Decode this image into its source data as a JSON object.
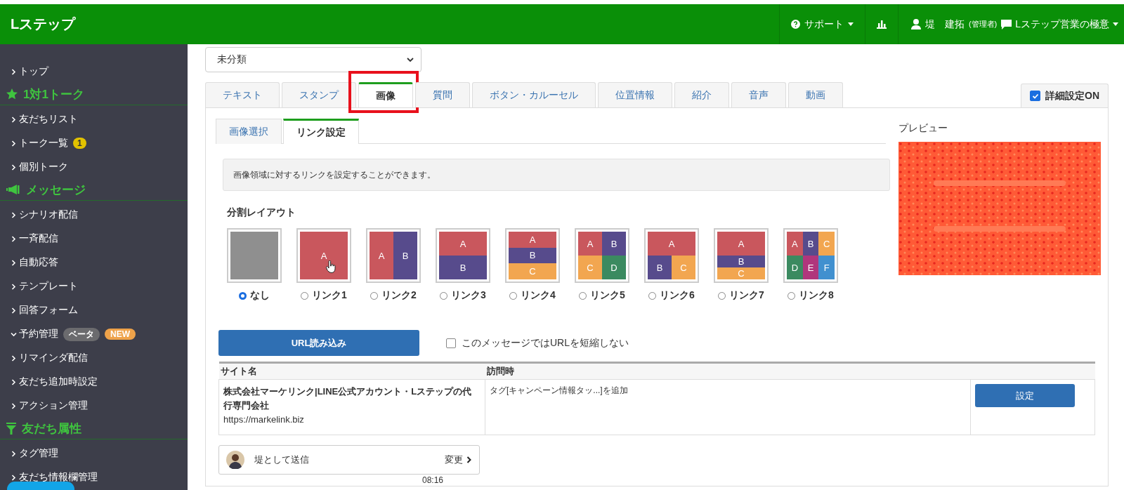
{
  "header": {
    "brand": "Lステップ",
    "support": "サポート",
    "user_name": "堤　建拓",
    "user_role": "(管理者)",
    "account": "Lステップ営業の極意"
  },
  "sidebar": {
    "items": [
      {
        "kind": "link",
        "label": "トップ",
        "expanded": false
      },
      {
        "kind": "section",
        "label": "1対1トーク"
      },
      {
        "kind": "link",
        "label": "友だちリスト",
        "expanded": false
      },
      {
        "kind": "link",
        "label": "トーク一覧",
        "expanded": false,
        "badges": [
          {
            "text": "1",
            "color": "#e2c200"
          }
        ]
      },
      {
        "kind": "link",
        "label": "個別トーク",
        "expanded": false
      },
      {
        "kind": "section",
        "label": "メッセージ"
      },
      {
        "kind": "link",
        "label": "シナリオ配信",
        "expanded": false
      },
      {
        "kind": "link",
        "label": "一斉配信",
        "expanded": false
      },
      {
        "kind": "link",
        "label": "自動応答",
        "expanded": false
      },
      {
        "kind": "link",
        "label": "テンプレート",
        "expanded": false
      },
      {
        "kind": "link",
        "label": "回答フォーム",
        "expanded": false
      },
      {
        "kind": "link",
        "label": "予約管理",
        "expanded": true,
        "badges": [
          {
            "text": "ベータ",
            "color": "#6b6b6e"
          },
          {
            "text": "NEW",
            "color": "#eea24a"
          }
        ]
      },
      {
        "kind": "link",
        "label": "リマインダ配信",
        "expanded": false
      },
      {
        "kind": "link",
        "label": "友だち追加時設定",
        "expanded": false
      },
      {
        "kind": "link",
        "label": "アクション管理",
        "expanded": false
      },
      {
        "kind": "section",
        "label": "友だち属性"
      },
      {
        "kind": "link",
        "label": "タグ管理",
        "expanded": false
      },
      {
        "kind": "link",
        "label": "友だち情報欄管理",
        "expanded": false
      }
    ]
  },
  "folder_select": {
    "value": "未分類"
  },
  "tabs": [
    {
      "label": "テキスト",
      "selected": false,
      "highlighted": false
    },
    {
      "label": "スタンプ",
      "selected": false,
      "highlighted": false
    },
    {
      "label": "画像",
      "selected": true,
      "highlighted": true
    },
    {
      "label": "質問",
      "selected": false,
      "highlighted": false
    },
    {
      "label": "ボタン・カルーセル",
      "selected": false,
      "highlighted": false
    },
    {
      "label": "位置情報",
      "selected": false,
      "highlighted": false
    },
    {
      "label": "紹介",
      "selected": false,
      "highlighted": false
    },
    {
      "label": "音声",
      "selected": false,
      "highlighted": false
    },
    {
      "label": "動画",
      "selected": false,
      "highlighted": false
    }
  ],
  "detail_toggle": {
    "label": "詳細設定ON",
    "checked": true
  },
  "subtabs": [
    {
      "label": "画像選択",
      "selected": false
    },
    {
      "label": "リンク設定",
      "selected": true
    }
  ],
  "info": "画像領域に対するリンクを設定することができます。",
  "layout_heading": "分割レイアウト",
  "layouts": [
    {
      "kind": "none",
      "label": "なし",
      "selected": true
    },
    {
      "kind": "full",
      "label": "リンク1",
      "selected": false,
      "cells": [
        {
          "label": "A",
          "color": "#c9575d"
        }
      ]
    },
    {
      "kind": "cols2",
      "label": "リンク2",
      "selected": false,
      "cells": [
        {
          "label": "A",
          "color": "#c9575d"
        },
        {
          "label": "B",
          "color": "#574b8c"
        }
      ]
    },
    {
      "kind": "rows2",
      "label": "リンク3",
      "selected": false,
      "cells": [
        {
          "label": "A",
          "color": "#c9575d"
        },
        {
          "label": "B",
          "color": "#574b8c"
        }
      ]
    },
    {
      "kind": "rows3",
      "label": "リンク4",
      "selected": false,
      "cells": [
        {
          "label": "A",
          "color": "#c9575d"
        },
        {
          "label": "B",
          "color": "#574b8c"
        },
        {
          "label": "C",
          "color": "#f2a650"
        }
      ]
    },
    {
      "kind": "grid4",
      "label": "リンク5",
      "selected": false,
      "cells": [
        {
          "label": "A",
          "color": "#c9575d"
        },
        {
          "label": "B",
          "color": "#574b8c"
        },
        {
          "label": "C",
          "color": "#f2a650"
        },
        {
          "label": "D",
          "color": "#3b8a60"
        }
      ]
    },
    {
      "kind": "top1bottom2",
      "label": "リンク6",
      "selected": false,
      "cells": [
        {
          "label": "A",
          "color": "#c9575d"
        },
        {
          "label": "B",
          "color": "#574b8c"
        },
        {
          "label": "C",
          "color": "#f2a650"
        }
      ]
    },
    {
      "kind": "big1thin2",
      "label": "リンク7",
      "selected": false,
      "cells": [
        {
          "label": "A",
          "color": "#c9575d"
        },
        {
          "label": "B",
          "color": "#574b8c"
        },
        {
          "label": "C",
          "color": "#f2a650"
        }
      ]
    },
    {
      "kind": "grid6",
      "label": "リンク8",
      "selected": false,
      "cells": [
        {
          "label": "A",
          "color": "#c9575d"
        },
        {
          "label": "B",
          "color": "#574b8c"
        },
        {
          "label": "C",
          "color": "#f2a650"
        },
        {
          "label": "D",
          "color": "#3b8a60"
        },
        {
          "label": "E",
          "color": "#b0367c"
        },
        {
          "label": "F",
          "color": "#4190cf"
        }
      ]
    }
  ],
  "url_button": "URL読み込み",
  "shorten_option": {
    "label": "このメッセージではURLを短縮しない",
    "checked": false
  },
  "table": {
    "columns": [
      "サイト名",
      "訪問時"
    ],
    "rows": [
      {
        "site_title": "株式会社マーケリンク|LINE公式アカウント・Lステップの代行専門会社",
        "site_url": "https://markelink.biz",
        "action": "タグ[キャンペーン情報タッ...]を追加",
        "button": "設定"
      }
    ]
  },
  "preview_label": "プレビュー",
  "sender": {
    "label": "堤として送信",
    "change": "変更"
  },
  "time": "08:16"
}
